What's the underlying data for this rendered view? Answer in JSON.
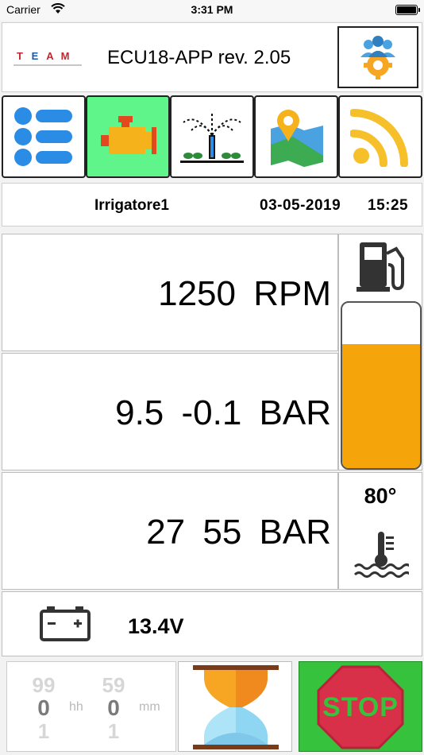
{
  "status_bar": {
    "carrier": "Carrier",
    "time": "3:31 PM"
  },
  "header": {
    "logo_letters": [
      "T",
      "E",
      "A",
      "M"
    ],
    "title": "ECU18-APP rev. 2.05"
  },
  "nav": {
    "items": [
      {
        "icon": "list-icon",
        "active": false
      },
      {
        "icon": "engine-icon",
        "active": true
      },
      {
        "icon": "sprinkler-icon",
        "active": false
      },
      {
        "icon": "map-icon",
        "active": false
      },
      {
        "icon": "rss-feed-icon",
        "active": false
      }
    ],
    "active_color": "#5ff58a"
  },
  "info": {
    "name": "Irrigatore1",
    "date": "03-05-2019",
    "time": "15:25"
  },
  "readings": {
    "rpm": "1250  RPM",
    "pressure1": "9.5  -0.1  BAR",
    "pressure2": "27  55  BAR"
  },
  "fuel": {
    "level_fraction": 0.75,
    "fill_color": "#f5a40a"
  },
  "temperature": {
    "value": "80°"
  },
  "battery": {
    "voltage": "13.4V"
  },
  "timer": {
    "hours": {
      "above": "99",
      "value": "0",
      "below": "1",
      "unit": "hh"
    },
    "minutes": {
      "above": "59",
      "value": "0",
      "below": "1",
      "unit": "mm"
    }
  },
  "stop_button": {
    "label": "STOP",
    "bg_color": "#36c23c",
    "sign_color": "#d9304a"
  }
}
